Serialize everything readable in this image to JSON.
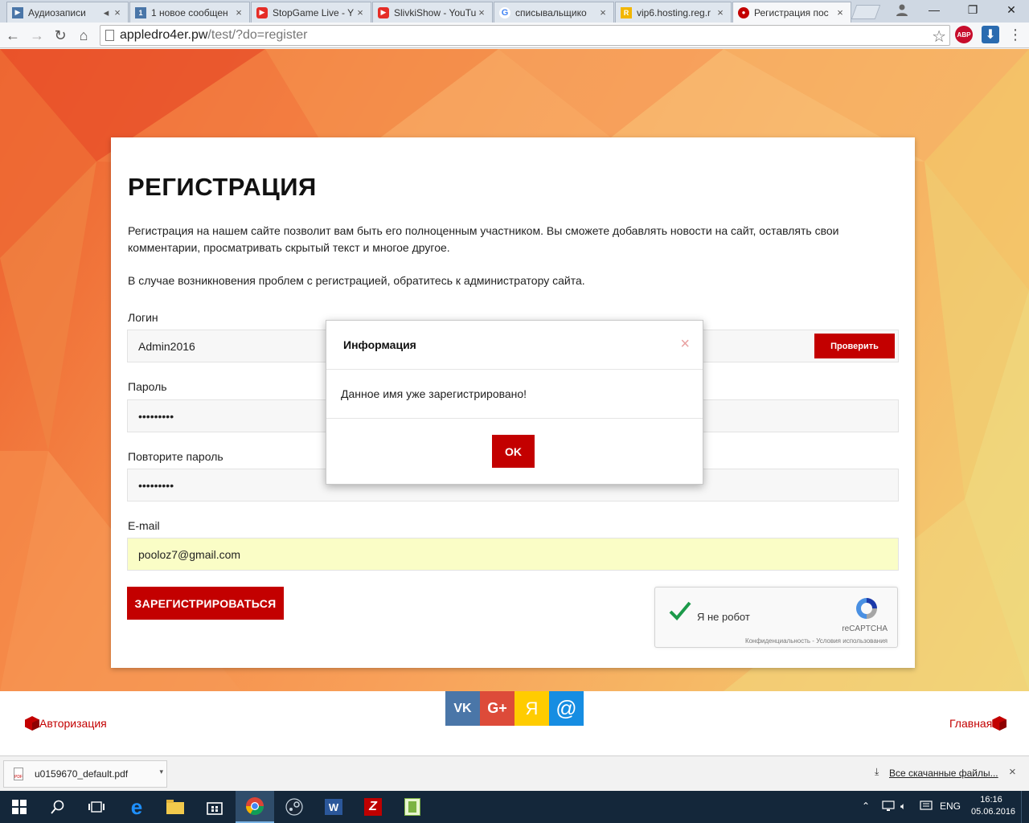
{
  "browser": {
    "tabs": [
      {
        "title": "Аудиозаписи",
        "favicon_color": "#4a76a8",
        "favicon_text": "▶"
      },
      {
        "title": "1 новое сообщен",
        "favicon_color": "#4a76a8",
        "favicon_text": "1"
      },
      {
        "title": "StopGame Live - Y",
        "favicon_color": "#e52d27",
        "favicon_text": "▶"
      },
      {
        "title": "SlivkiShow - YouTu",
        "favicon_color": "#e52d27",
        "favicon_text": "▶"
      },
      {
        "title": "списывальщико",
        "favicon_color": "#4285f4",
        "favicon_text": "G"
      },
      {
        "title": "vip6.hosting.reg.r",
        "favicon_color": "#f2b600",
        "favicon_text": "R"
      },
      {
        "title": "Регистрация пос",
        "favicon_color": "#c30000",
        "favicon_text": "●"
      }
    ],
    "url_host": "appledro4er.pw",
    "url_path": "/test/?do=register",
    "ext_abp": "ABP"
  },
  "page": {
    "title": "РЕГИСТРАЦИЯ",
    "intro": "Регистрация на нашем сайте позволит вам быть его полноценным участником. Вы сможете добавлять новости на сайт, оставлять свои комментарии, просматривать скрытый текст и многое другое.",
    "help": "В случае возникновения проблем с регистрацией, обратитесь к администратору сайта.",
    "login_label": "Логин",
    "login_value": "Admin2016",
    "check_button": "Проверить",
    "password_label": "Пароль",
    "password_value": "•••••••••",
    "repeat_label": "Повторите пароль",
    "repeat_value": "•••••••••",
    "email_label": "E-mail",
    "email_value": "pooloz7@gmail.com",
    "submit_button": "ЗАРЕГИСТРИРОВАТЬСЯ",
    "recaptcha": {
      "label": "Я не робот",
      "brand": "reCAPTCHA",
      "terms": "Конфиденциальность - Условия использования"
    }
  },
  "modal": {
    "title": "Информация",
    "message": "Данное имя уже зарегистрировано!",
    "ok": "OK",
    "close": "×"
  },
  "footer": {
    "auth_link": "Авторизация",
    "home_link": "Главная",
    "social": [
      {
        "label": "VK",
        "color": "#4a76a8"
      },
      {
        "label": "G+",
        "color": "#dd4b39"
      },
      {
        "label": "Я",
        "color": "#ffcc00"
      },
      {
        "label": "@",
        "color": "#168de2"
      }
    ]
  },
  "downloads": {
    "file": "u0159670_default.pdf",
    "show_all": "Все скачанные файлы..."
  },
  "taskbar": {
    "lang": "ENG",
    "time": "16:16",
    "date": "05.06.2016"
  }
}
